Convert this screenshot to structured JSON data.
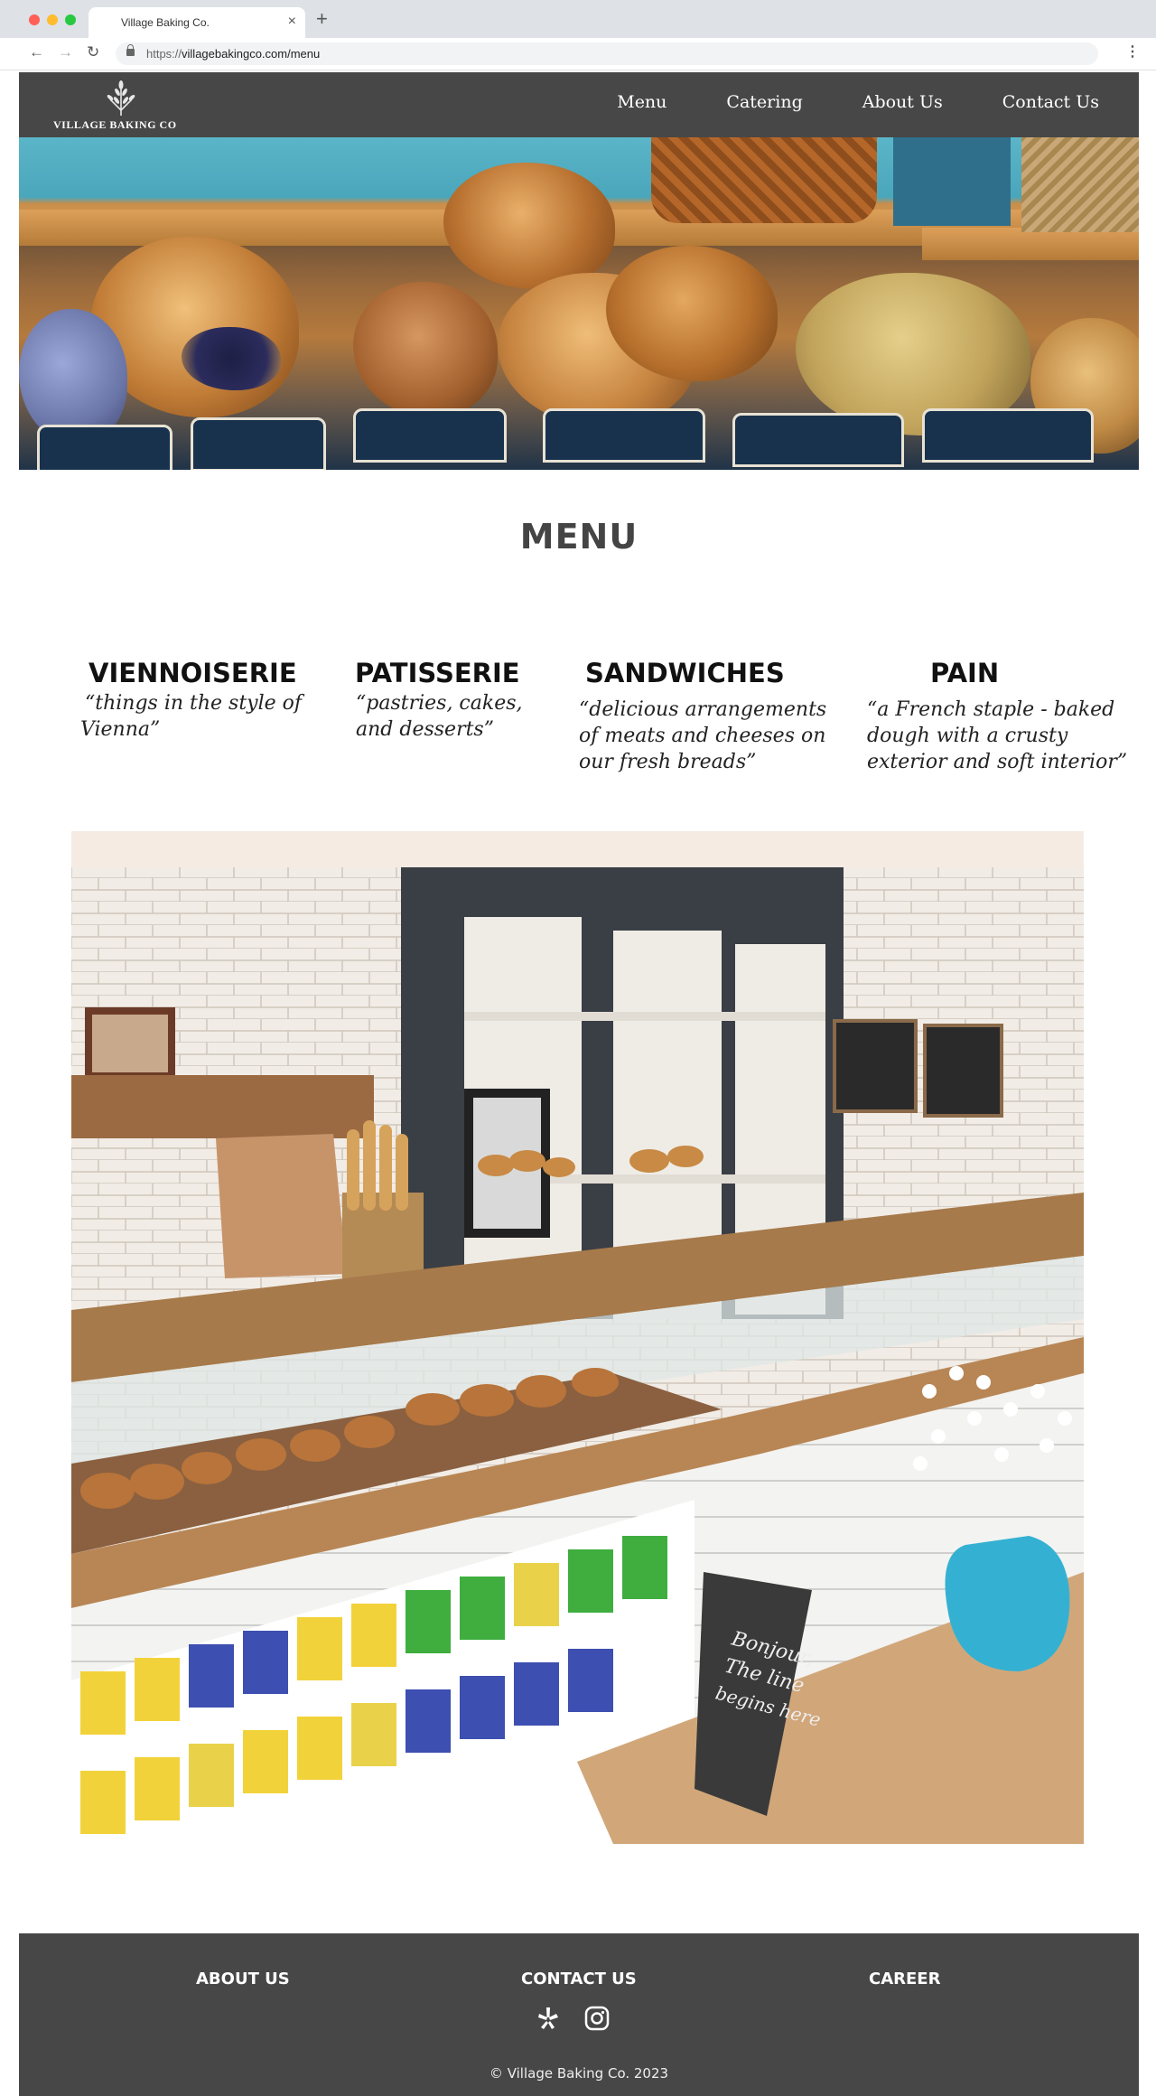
{
  "browser": {
    "tab_title": "Village Baking Co.",
    "tab_close": "×",
    "new_tab": "+",
    "url_protocol": "https://",
    "url_path": "villagebakingco.com/menu",
    "back": "←",
    "forward": "→",
    "reload": "↻",
    "menu": "⋮",
    "traffic_lights": [
      "#ff5f57",
      "#febc2e",
      "#28c840"
    ]
  },
  "header": {
    "logo_text": "VILLAGE BAKING CO",
    "logo_icon": "wheat-icon",
    "nav": [
      "Menu",
      "Catering",
      "About Us",
      "Contact Us"
    ]
  },
  "page": {
    "title": "MENU"
  },
  "categories": [
    {
      "title": "VIENNOISERIE",
      "desc_lines": [
        "“things in the style of",
        "Vienna”"
      ]
    },
    {
      "title": "PATISSERIE",
      "desc_lines": [
        "“pastries, cakes,",
        "and desserts”"
      ]
    },
    {
      "title": "SANDWICHES",
      "desc_lines": [
        "“delicious arrangements",
        "of meats and cheeses on",
        "our fresh breads”"
      ]
    },
    {
      "title": "PAIN",
      "desc_lines": [
        "“a French staple - baked",
        "dough with a crusty",
        "exterior and soft interior”"
      ]
    }
  ],
  "photo": {
    "chalk_sign": [
      "Bonjour,",
      "The line",
      "begins here"
    ]
  },
  "footer": {
    "links": [
      "ABOUT US",
      "CONTACT US",
      "CAREER"
    ],
    "social_icons": [
      "yelp-icon",
      "instagram-icon"
    ],
    "copyright": "© Village Baking Co. 2023"
  },
  "colors": {
    "header_bg": "#474747",
    "footer_bg": "#474747"
  }
}
